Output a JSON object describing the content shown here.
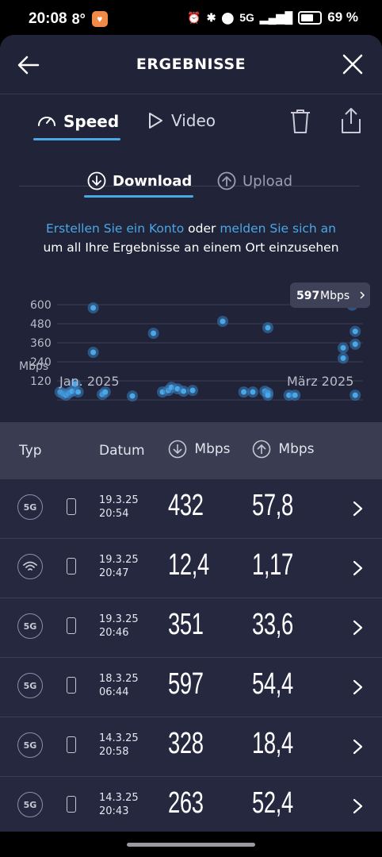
{
  "status_bar": {
    "time": "20:08",
    "temperature": "8°",
    "network": "5G",
    "battery": "69 %"
  },
  "header": {
    "title": "ERGEBNISSE"
  },
  "tabs": [
    {
      "label": "Speed",
      "active": true
    },
    {
      "label": "Video",
      "active": false
    }
  ],
  "subtabs": [
    {
      "label": "Download",
      "active": true
    },
    {
      "label": "Upload",
      "active": false
    }
  ],
  "info": {
    "link1": "Erstellen Sie ein Konto",
    "mid": "oder",
    "link2": "melden Sie sich an",
    "line2": "um all Ihre Ergebnisse an einem Ort einzusehen"
  },
  "colors": {
    "accent": "#4aa8e6",
    "background": "#262840",
    "header_bg": "#212338",
    "table_header_bg": "#3a3c52"
  },
  "chart_data": {
    "type": "scatter",
    "y_ticks": [
      "600",
      "480",
      "360",
      "240",
      "120"
    ],
    "ylabel": "Mbps",
    "x_labels": [
      "Jan. 2025",
      "März 2025"
    ],
    "ylim": [
      0,
      600
    ],
    "tooltip": {
      "value": "597",
      "unit": "Mbps"
    },
    "points": [
      {
        "x": 0.01,
        "y": 50
      },
      {
        "x": 0.02,
        "y": 40
      },
      {
        "x": 0.03,
        "y": 30
      },
      {
        "x": 0.04,
        "y": 45
      },
      {
        "x": 0.05,
        "y": 55
      },
      {
        "x": 0.06,
        "y": 100
      },
      {
        "x": 0.07,
        "y": 50
      },
      {
        "x": 0.12,
        "y": 580
      },
      {
        "x": 0.12,
        "y": 300
      },
      {
        "x": 0.15,
        "y": 35
      },
      {
        "x": 0.16,
        "y": 50
      },
      {
        "x": 0.25,
        "y": 25
      },
      {
        "x": 0.32,
        "y": 420
      },
      {
        "x": 0.35,
        "y": 50
      },
      {
        "x": 0.37,
        "y": 60
      },
      {
        "x": 0.38,
        "y": 80
      },
      {
        "x": 0.4,
        "y": 70
      },
      {
        "x": 0.42,
        "y": 55
      },
      {
        "x": 0.45,
        "y": 60
      },
      {
        "x": 0.55,
        "y": 495
      },
      {
        "x": 0.62,
        "y": 50
      },
      {
        "x": 0.65,
        "y": 50
      },
      {
        "x": 0.69,
        "y": 55
      },
      {
        "x": 0.7,
        "y": 45
      },
      {
        "x": 0.7,
        "y": 30
      },
      {
        "x": 0.7,
        "y": 455
      },
      {
        "x": 0.77,
        "y": 30
      },
      {
        "x": 0.79,
        "y": 30
      },
      {
        "x": 0.95,
        "y": 328
      },
      {
        "x": 0.95,
        "y": 263
      },
      {
        "x": 0.98,
        "y": 597
      },
      {
        "x": 0.99,
        "y": 432
      },
      {
        "x": 0.99,
        "y": 351
      },
      {
        "x": 0.99,
        "y": 30
      }
    ]
  },
  "table": {
    "headers": {
      "type": "Typ",
      "date": "Datum",
      "download": "Mbps",
      "upload": "Mbps"
    },
    "rows": [
      {
        "type": "5G",
        "date": "19.3.25",
        "time": "20:54",
        "download": "432",
        "upload": "57,8"
      },
      {
        "type": "wifi",
        "date": "19.3.25",
        "time": "20:47",
        "download": "12,4",
        "upload": "1,17"
      },
      {
        "type": "5G",
        "date": "19.3.25",
        "time": "20:46",
        "download": "351",
        "upload": "33,6"
      },
      {
        "type": "5G",
        "date": "18.3.25",
        "time": "06:44",
        "download": "597",
        "upload": "54,4"
      },
      {
        "type": "5G",
        "date": "14.3.25",
        "time": "20:58",
        "download": "328",
        "upload": "18,4"
      },
      {
        "type": "5G",
        "date": "14.3.25",
        "time": "20:43",
        "download": "263",
        "upload": "52,4"
      }
    ]
  }
}
